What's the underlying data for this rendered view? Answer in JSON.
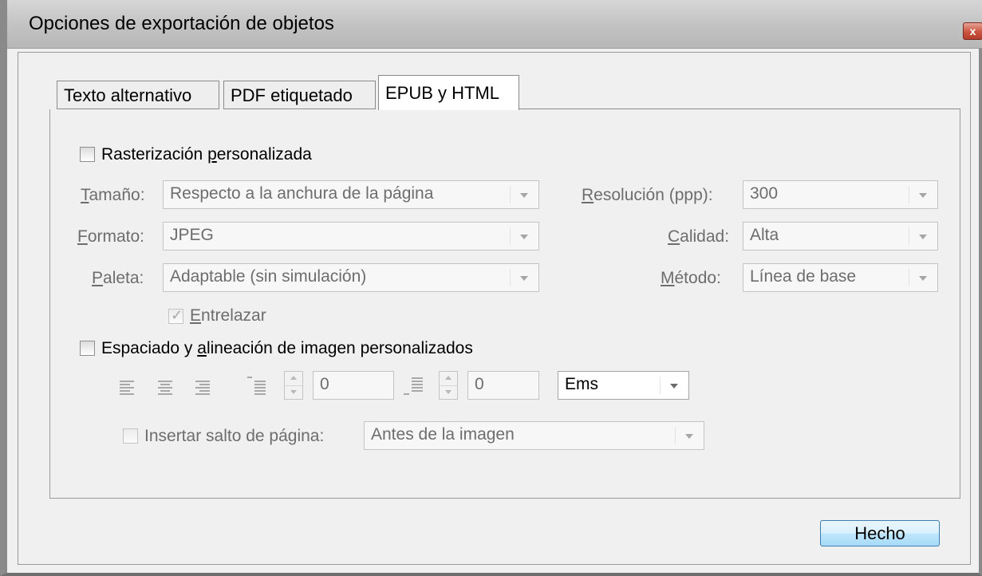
{
  "window": {
    "title": "Opciones de exportación de objetos",
    "close_label": "x"
  },
  "tabs": [
    {
      "label": "Texto alternativo",
      "active": false
    },
    {
      "label": "PDF etiquetado",
      "active": false
    },
    {
      "label": "EPUB y HTML",
      "active": true
    }
  ],
  "raster": {
    "checkbox_label_pre": "Rasterización ",
    "checkbox_label_u": "p",
    "checkbox_label_post": "ersonalizada",
    "checked": false,
    "size": {
      "label_u": "T",
      "label_rest": "amaño:",
      "value": "Respecto a la anchura de la página"
    },
    "format": {
      "label_u": "F",
      "label_rest": "ormato:",
      "value": "JPEG"
    },
    "palette": {
      "label_u": "P",
      "label_rest": "aleta:",
      "value": "Adaptable (sin simulación)"
    },
    "resolution": {
      "label_u": "R",
      "label_rest": "esolución (ppp):",
      "value": "300"
    },
    "quality": {
      "label_u": "C",
      "label_rest": "alidad:",
      "value": "Alta"
    },
    "method": {
      "label_u": "M",
      "label_rest": "étodo:",
      "value": "Línea de base"
    },
    "interlace": {
      "label_u": "E",
      "label_rest": "ntrelazar",
      "checked": true
    }
  },
  "spacing": {
    "checkbox_label_pre": "Espaciado y ",
    "checkbox_label_u": "a",
    "checkbox_label_post": "lineación de imagen personalizados",
    "checked": false,
    "space_before": "0",
    "space_after": "0",
    "units": "Ems",
    "page_break": {
      "label": "Insertar salto de página:",
      "checked": false,
      "value": "Antes de la imagen"
    }
  },
  "buttons": {
    "done": "Hecho"
  }
}
